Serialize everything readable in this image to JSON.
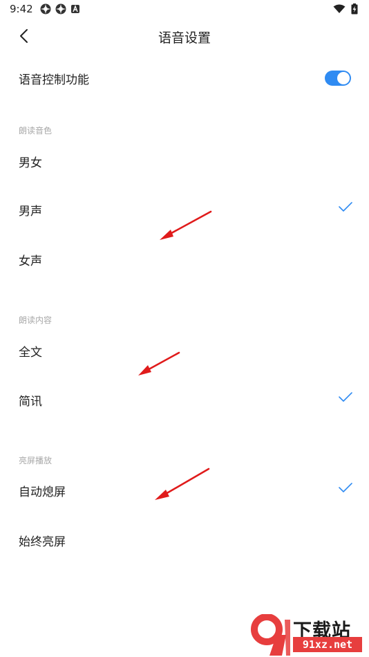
{
  "status_bar": {
    "time": "9:42",
    "left_icons": [
      "settings-app-icon",
      "settings-app-icon",
      "a-notification-icon"
    ],
    "right_icons": [
      "wifi-icon",
      "battery-charging-icon"
    ]
  },
  "header": {
    "title": "语音设置",
    "back_icon": "chevron-left-icon"
  },
  "voice_control": {
    "label": "语音控制功能",
    "enabled": true
  },
  "voice_tone": {
    "section_title": "朗读音色",
    "options": [
      {
        "label": "男女",
        "selected": false
      },
      {
        "label": "男声",
        "selected": true
      },
      {
        "label": "女声",
        "selected": false
      }
    ]
  },
  "read_content": {
    "section_title": "朗读内容",
    "options": [
      {
        "label": "全文",
        "selected": false
      },
      {
        "label": "简讯",
        "selected": true
      }
    ]
  },
  "screen_on": {
    "section_title": "亮屏播放",
    "options": [
      {
        "label": "自动熄屏",
        "selected": true
      },
      {
        "label": "始终亮屏",
        "selected": false
      }
    ]
  },
  "watermark": {
    "title": "下载站",
    "domain": "91xz.net",
    "logo_text": "9"
  },
  "colors": {
    "accent": "#2f8bf2",
    "section_text": "#a8a8a8",
    "annotation_arrow": "#e01b1b",
    "watermark_red": "#e73e3e"
  }
}
